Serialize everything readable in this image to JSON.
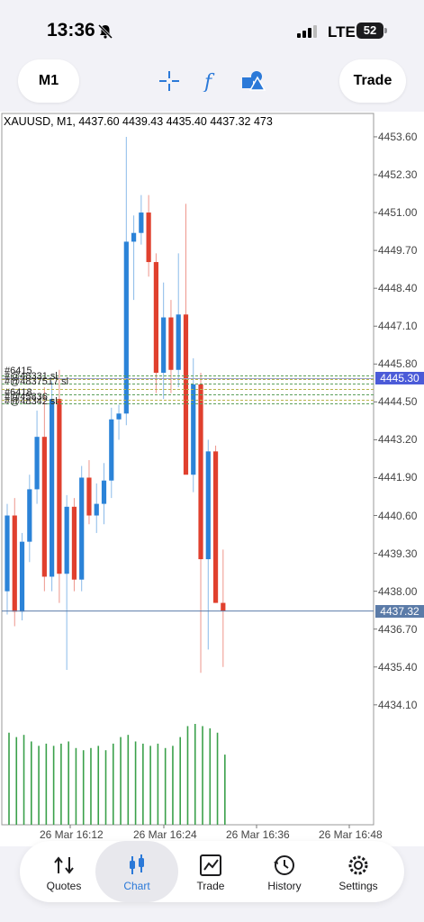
{
  "status_bar": {
    "time": "13:36",
    "network": "LTE",
    "battery": "52",
    "icons": [
      "bell-slash-icon",
      "signal-icon"
    ]
  },
  "toolbar": {
    "timeframe": "M1",
    "trade_label": "Trade",
    "icons": [
      "crosshair-icon",
      "indicator-f-icon",
      "objects-icon"
    ],
    "accent_color": "#2b79d8"
  },
  "chart": {
    "info": "XAUUSD, M1, 4437.60 4439.43 4435.40 4437.32 473",
    "price_labels": [
      "4453.60",
      "4452.30",
      "4451.00",
      "4449.70",
      "4448.40",
      "4447.10",
      "4445.80",
      "4444.50",
      "4443.20",
      "4441.90",
      "4440.60",
      "4439.30",
      "4438.00",
      "4436.70",
      "4435.40",
      "4434.10"
    ],
    "bid_price": "4437.32",
    "bid_color": "#5b7ba8",
    "order_price": "4445.30",
    "order_color": "#4b5bd8",
    "time_labels": [
      "26 Mar 16:12",
      "26 Mar 16:24",
      "26 Mar 16:36",
      "26 Mar 16:48"
    ],
    "order_labels_top": [
      "#6415",
      "#@48331 sl",
      "#@4837517 sl"
    ],
    "order_labels_bottom": [
      "#6418",
      "#@45836",
      "#@48342 sl"
    ],
    "up_color": "#2b83d8",
    "down_color": "#e0402e",
    "volume_color": "#3aa04a"
  },
  "chart_data": {
    "type": "candlestick",
    "ylim": [
      4433.6,
      4454.0
    ],
    "candles": [
      {
        "o": 4438.0,
        "h": 4441.0,
        "l": 4437.2,
        "c": 4440.6
      },
      {
        "o": 4440.6,
        "h": 4441.2,
        "l": 4436.8,
        "c": 4437.3
      },
      {
        "o": 4437.3,
        "h": 4440.0,
        "l": 4437.0,
        "c": 4439.7
      },
      {
        "o": 4439.7,
        "h": 4442.0,
        "l": 4439.0,
        "c": 4441.5
      },
      {
        "o": 4441.5,
        "h": 4444.2,
        "l": 4441.0,
        "c": 4443.3
      },
      {
        "o": 4443.3,
        "h": 4445.0,
        "l": 4438.0,
        "c": 4438.5
      },
      {
        "o": 4438.5,
        "h": 4445.2,
        "l": 4438.0,
        "c": 4444.6
      },
      {
        "o": 4444.6,
        "h": 4445.6,
        "l": 4437.6,
        "c": 4438.6
      },
      {
        "o": 4438.6,
        "h": 4441.3,
        "l": 4435.3,
        "c": 4440.9
      },
      {
        "o": 4440.9,
        "h": 4441.2,
        "l": 4438.0,
        "c": 4438.4
      },
      {
        "o": 4438.4,
        "h": 4442.3,
        "l": 4438.0,
        "c": 4441.9
      },
      {
        "o": 4441.9,
        "h": 4442.5,
        "l": 4440.3,
        "c": 4440.6
      },
      {
        "o": 4440.6,
        "h": 4441.7,
        "l": 4440.0,
        "c": 4441.0
      },
      {
        "o": 4441.0,
        "h": 4442.4,
        "l": 4440.3,
        "c": 4441.8
      },
      {
        "o": 4441.8,
        "h": 4444.3,
        "l": 4441.2,
        "c": 4443.9
      },
      {
        "o": 4443.9,
        "h": 4444.4,
        "l": 4443.2,
        "c": 4444.1
      },
      {
        "o": 4444.1,
        "h": 4453.6,
        "l": 4443.7,
        "c": 4450.0
      },
      {
        "o": 4450.0,
        "h": 4450.9,
        "l": 4448.0,
        "c": 4450.3
      },
      {
        "o": 4450.3,
        "h": 4451.6,
        "l": 4449.9,
        "c": 4451.0
      },
      {
        "o": 4451.0,
        "h": 4451.6,
        "l": 4448.8,
        "c": 4449.3
      },
      {
        "o": 4449.3,
        "h": 4449.6,
        "l": 4444.8,
        "c": 4445.5
      },
      {
        "o": 4445.5,
        "h": 4448.6,
        "l": 4444.6,
        "c": 4447.4
      },
      {
        "o": 4447.4,
        "h": 4448.0,
        "l": 4444.8,
        "c": 4445.6
      },
      {
        "o": 4445.6,
        "h": 4449.6,
        "l": 4445.0,
        "c": 4447.5
      },
      {
        "o": 4447.5,
        "h": 4451.3,
        "l": 4443.5,
        "c": 4442.0
      },
      {
        "o": 4442.0,
        "h": 4446.0,
        "l": 4441.4,
        "c": 4445.1
      },
      {
        "o": 4445.1,
        "h": 4445.5,
        "l": 4435.2,
        "c": 4439.1
      },
      {
        "o": 4439.1,
        "h": 4443.2,
        "l": 4436.0,
        "c": 4442.8
      },
      {
        "o": 4442.8,
        "h": 4443.0,
        "l": 4437.6,
        "c": 4437.6
      },
      {
        "o": 4437.6,
        "h": 4439.43,
        "l": 4435.4,
        "c": 4437.32
      }
    ],
    "volume": [
      42,
      40,
      41,
      38,
      36,
      37,
      36,
      37,
      38,
      35,
      34,
      35,
      36,
      34,
      37,
      40,
      41,
      38,
      37,
      36,
      37,
      35,
      36,
      40,
      45,
      46,
      45,
      44,
      42,
      32
    ]
  },
  "bottom_nav": {
    "items": [
      {
        "label": "Quotes",
        "icon": "quotes-icon"
      },
      {
        "label": "Chart",
        "icon": "chart-icon"
      },
      {
        "label": "Trade",
        "icon": "trade-icon"
      },
      {
        "label": "History",
        "icon": "history-icon"
      },
      {
        "label": "Settings",
        "icon": "settings-icon"
      }
    ],
    "active": "Chart"
  }
}
